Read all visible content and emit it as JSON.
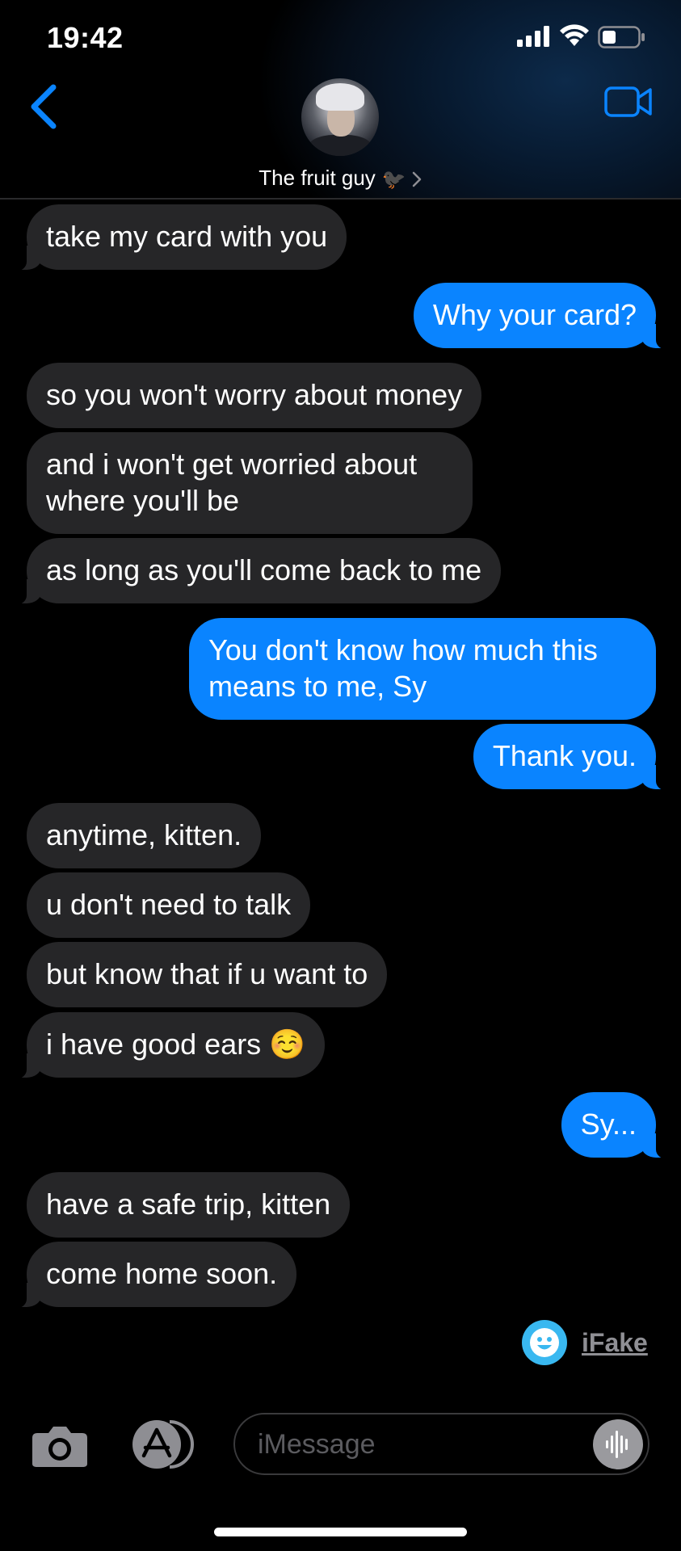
{
  "status_bar": {
    "time": "19:42"
  },
  "header": {
    "contact_name": "The fruit guy",
    "contact_emoji": "🐦‍⬛"
  },
  "messages": [
    {
      "side": "in",
      "text": "take my card with you"
    },
    {
      "side": "out",
      "text": "Why your card?"
    },
    {
      "side": "in",
      "text": "so you won't worry about money"
    },
    {
      "side": "in",
      "text": "and i won't get worried about where you'll be"
    },
    {
      "side": "in",
      "text": "as long as you'll come back to me"
    },
    {
      "side": "out",
      "text": "You don't know how much this means to me, Sy"
    },
    {
      "side": "out",
      "text": "Thank you."
    },
    {
      "side": "in",
      "text": "anytime, kitten."
    },
    {
      "side": "in",
      "text": "u don't need to talk"
    },
    {
      "side": "in",
      "text": "but know that if u want to"
    },
    {
      "side": "in",
      "text": "i have good ears ☺️"
    },
    {
      "side": "out",
      "text": "Sy..."
    },
    {
      "side": "in",
      "text": "have a safe trip, kitten"
    },
    {
      "side": "in",
      "text": "come home soon."
    }
  ],
  "watermark": {
    "text": "iFake"
  },
  "input_bar": {
    "placeholder": "iMessage"
  },
  "colors": {
    "outgoing_bubble": "#0a84ff",
    "incoming_bubble": "#262628",
    "accent": "#0a84ff"
  }
}
